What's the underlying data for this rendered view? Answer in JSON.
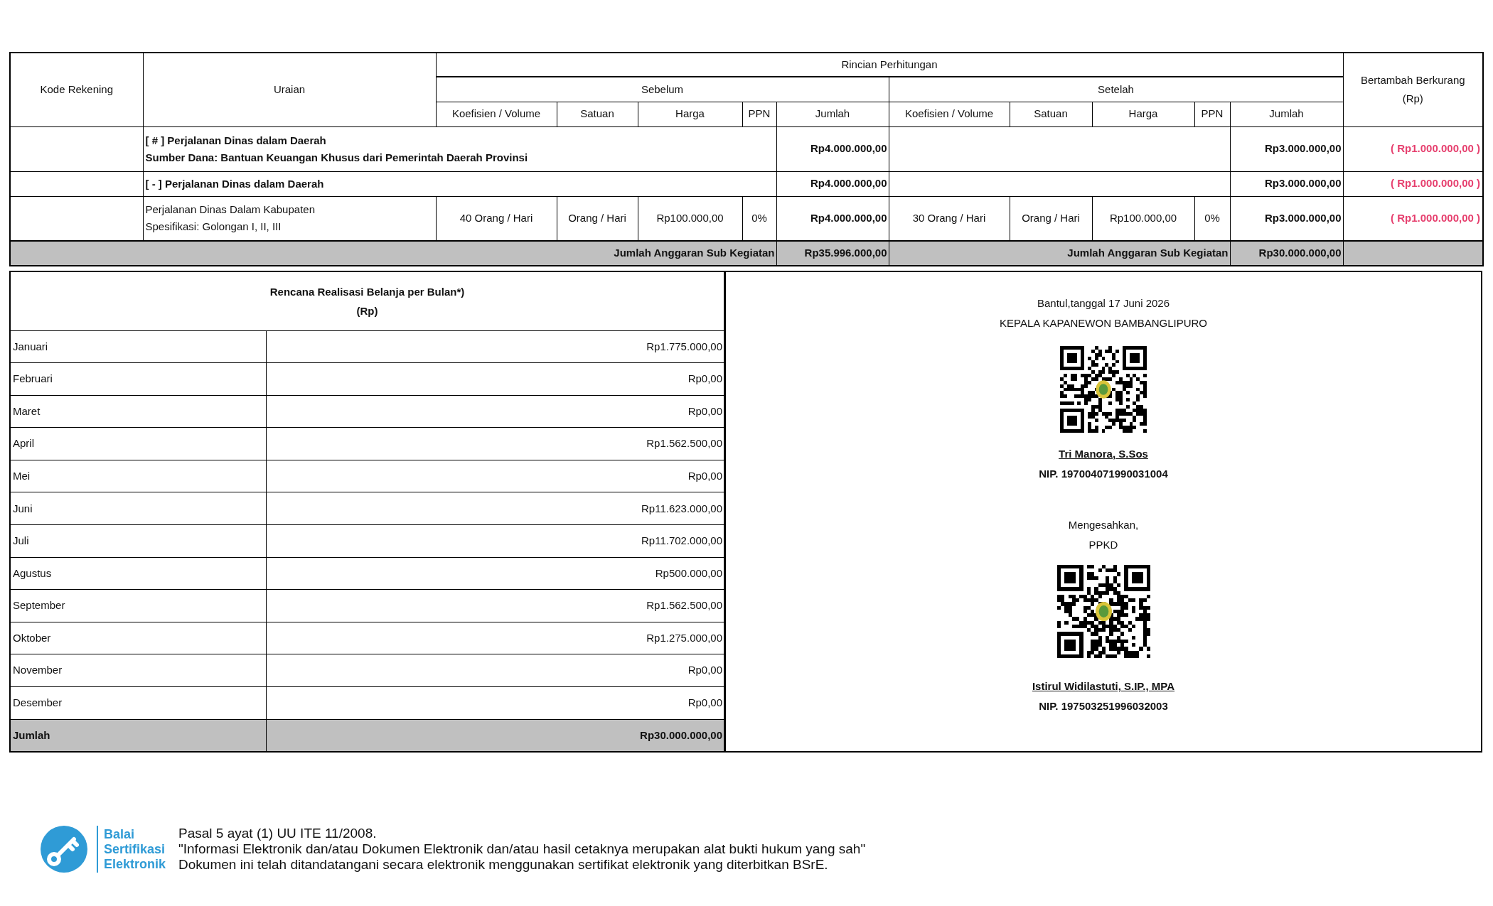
{
  "budget_table": {
    "header": {
      "kode_rekening": "Kode Rekening",
      "uraian": "Uraian",
      "rincian": "Rincian Perhitungan",
      "sebelum": "Sebelum",
      "setelah": "Setelah",
      "selisih": [
        "Bertambah Berkurang",
        "(Rp)"
      ]
    },
    "sebelum_columns": [
      "Koefisien / Volume",
      "Satuan",
      "Harga",
      "PPN",
      "Jumlah"
    ],
    "setelah_columns": [
      "Koefisien / Volume",
      "Satuan",
      "Harga",
      "PPN",
      "Jumlah"
    ],
    "rows": [
      {
        "kind": "group",
        "lines": [
          "[ # ] Perjalanan Dinas dalam Daerah",
          "Sumber Dana: Bantuan Keuangan Khusus dari Pemerintah Daerah Provinsi"
        ],
        "jumlah_sebelum": "Rp4.000.000,00",
        "jumlah_setelah": "Rp3.000.000,00",
        "selisih": "( Rp1.000.000,00 )"
      },
      {
        "kind": "group",
        "lines": [
          "[ - ] Perjalanan Dinas dalam Daerah"
        ],
        "jumlah_sebelum": "Rp4.000.000,00",
        "jumlah_setelah": "Rp3.000.000,00",
        "selisih": "( Rp1.000.000,00 )"
      },
      {
        "kind": "item",
        "lines": [
          "Perjalanan Dinas Dalam Kabupaten",
          "Spesifikasi: Golongan I, II, III"
        ],
        "sebelum": [
          "40 Orang / Hari",
          "Orang / Hari",
          "Rp100.000,00",
          "0%"
        ],
        "jumlah_sebelum": "Rp4.000.000,00",
        "setelah": [
          "30 Orang / Hari",
          "Orang / Hari",
          "Rp100.000,00",
          "0%"
        ],
        "jumlah_setelah": "Rp3.000.000,00",
        "selisih": "( Rp1.000.000,00 )"
      }
    ],
    "total": {
      "label_sebelum": "Jumlah Anggaran Sub Kegiatan",
      "jumlah_sebelum": "Rp35.996.000,00",
      "label_setelah": "Jumlah Anggaran Sub Kegiatan",
      "jumlah_setelah": "Rp30.000.000,00"
    }
  },
  "monthly_plan": {
    "title": [
      "Rencana Realisasi Belanja per Bulan*)",
      "(Rp)"
    ],
    "rows": [
      {
        "month": "Januari",
        "amount": "Rp1.775.000,00"
      },
      {
        "month": "Februari",
        "amount": "Rp0,00"
      },
      {
        "month": "Maret",
        "amount": "Rp0,00"
      },
      {
        "month": "April",
        "amount": "Rp1.562.500,00"
      },
      {
        "month": "Mei",
        "amount": "Rp0,00"
      },
      {
        "month": "Juni",
        "amount": "Rp11.623.000,00"
      },
      {
        "month": "Juli",
        "amount": "Rp11.702.000,00"
      },
      {
        "month": "Agustus",
        "amount": "Rp500.000,00"
      },
      {
        "month": "September",
        "amount": "Rp1.562.500,00"
      },
      {
        "month": "Oktober",
        "amount": "Rp1.275.000,00"
      },
      {
        "month": "November",
        "amount": "Rp0,00"
      },
      {
        "month": "Desember",
        "amount": "Rp0,00"
      }
    ],
    "total": {
      "label": "Jumlah",
      "amount": "Rp30.000.000,00"
    }
  },
  "signatures": {
    "place_date": "Bantul,tanggal 17 Juni 2026",
    "position": "KEPALA KAPANEWON BAMBANGLIPURO",
    "signer": {
      "name": "Tri Manora, S.Sos",
      "nip": "NIP. 197004071990031004"
    },
    "approval": [
      "Mengesahkan,",
      "PPKD"
    ],
    "approver": {
      "name": "Istirul Widilastuti, S.IP., MPA",
      "nip": "NIP. 197503251996032003"
    }
  },
  "footer": {
    "logo_text": [
      "Balai",
      "Sertifikasi",
      "Elektronik"
    ],
    "lines": [
      "Pasal 5 ayat (1) UU ITE 11/2008.",
      "\"Informasi Elektronik dan/atau Dokumen Elektronik dan/atau hasil cetaknya merupakan alat bukti hukum yang sah\"",
      "Dokumen ini telah ditandatangani secara elektronik menggunakan sertifikat elektronik yang diterbitkan BSrE."
    ]
  }
}
